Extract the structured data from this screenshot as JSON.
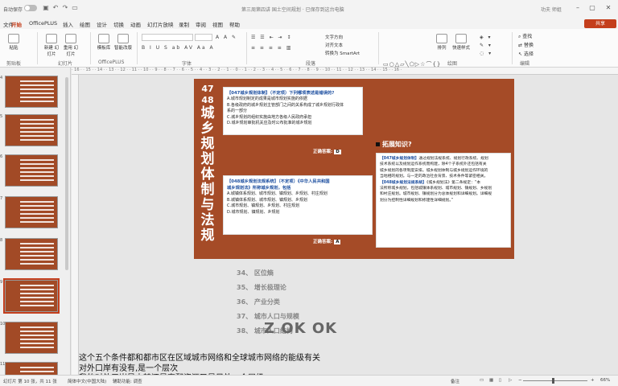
{
  "titlebar": {
    "autosave_label": "自动保存",
    "doc_title": "第三周第四讲 国土空间规划 · 已保存到这台电脑",
    "user_name": "功夫 师姐"
  },
  "menu": {
    "tabs": [
      "文件",
      "开始",
      "OfficePLUS",
      "插入",
      "绘图",
      "设计",
      "切换",
      "动画",
      "幻灯片放映",
      "录制",
      "审阅",
      "视图",
      "帮助"
    ],
    "active_tab": "开始",
    "share_label": "共享"
  },
  "ribbon": {
    "paste": "粘贴",
    "new_slide": "新建\n幻灯片",
    "reuse": "重用\n幻灯片",
    "template": "模板库",
    "smart": "智能改版",
    "font_name": "",
    "font_size": "",
    "group_clipboard": "剪贴板",
    "group_slides": "幻灯片",
    "group_officeplus": "OfficePLUS",
    "group_font": "字体",
    "group_paragraph": "段落",
    "group_drawing": "绘图",
    "group_editing": "编辑",
    "text_direction": "文字方向",
    "align_text": "对齐文本",
    "smartart": "转换为 SmartArt",
    "arrange": "排列",
    "quick_styles": "快速样式",
    "find": "查找",
    "replace": "替换",
    "select": "选择"
  },
  "ruler_text": "· 16 · · 15 · · 14 · · 13 · · 12 · · 11 · · 10 · · 9 · · 8 · · 7 · · 6 · · 5 · · 4 · · 3 · · 2 · · 1 · · 0 · · 1 · · 2 · · 3 · · 4 · · 5 · · 6 · · 7 · · 8 · · 9 · · 10 · · 11 · · 12 · · 13 · · 14 · · 15 · · 16 ·",
  "slide": {
    "title_num1": "47",
    "title_num2": "48",
    "title_chars": [
      "城",
      "乡",
      "规",
      "划",
      "体",
      "制",
      "与",
      "法",
      "规"
    ],
    "q1": {
      "head": "【047城乡规划体制】（不定项）下列哪项表述是错误的?",
      "options": [
        "A.城市规划制定的成果是城市规划实施的依据",
        "B.各级政府的城乡规划主管部门之间的关系构成了城乡规划行政体",
        "系的一部分",
        "C.城乡规划的组织实施由地方各级人民政府承担",
        "D.城乡规划审批机关应及时公布批准的城乡规划"
      ],
      "answer_label": "正确答案:",
      "answer_value": "D"
    },
    "q2": {
      "head": "【048城乡规划法规系统】（不定项）《中华人民共和国",
      "head2": "城乡规划法》所称城乡规划，包括",
      "options": [
        "A.城镇体系规划、城市规划、镇规划、乡规划、村庄规划",
        "B.城镇体系规划、城市规划、镇规划、乡规划",
        "C.城市规划、镇规划、乡规划、村庄规划",
        "D.城市规划、镇规划、乡规划"
      ],
      "answer_label": "正确答案:",
      "answer_value": "A"
    },
    "extension": {
      "label": "拓展知识?",
      "lines": [
        {
          "hl": "【047城乡规划体制】",
          "text": "通过规划法规系统、规划行政系统、规划"
        },
        {
          "hl": "",
          "text": "技术系统以及规划运作系统而构建，除4个子系统外还包括有关"
        },
        {
          "hl": "",
          "text": "城乡规划的各项制度安排。城乡规划体制与城乡规划运作环境的"
        },
        {
          "hl": "",
          "text": "当地相的规划。与一定的政治社会背景、技术条件等紧密相关。"
        },
        {
          "hl": "【048城乡规划法规系统】",
          "text": "《城乡规划法》第二条规定：“本"
        },
        {
          "hl": "",
          "text": "法所称城乡规划，包括城镇体系规划、城市规划、镇规划、乡规划"
        },
        {
          "hl": "",
          "text": "和村庄规划。城市规划、镇规划分为总体规划和详细规划。详细规"
        },
        {
          "hl": "",
          "text": "划分为控制性详细规划和修建性详细规划。”"
        }
      ]
    }
  },
  "notes": {
    "items": [
      "34、 区位熵",
      "35、 增长极理论",
      "36、 产业分类",
      "37、 城市人口与规模",
      "38、 城市人口结构"
    ],
    "watermark": "Z OK OK"
  },
  "subtitles": [
    "这个五个条件都和都市区在区域城市网络和全球城市网络的能级有关",
    "对外口岸有没有,是一个层次",
    "我的对外口岸是中转还是直配资源又是另外一个层级"
  ],
  "thumbnails": {
    "numbers": [
      "4",
      "5",
      "6",
      "7",
      "8",
      "9",
      "10",
      "11"
    ],
    "selected_index": 6
  },
  "status": {
    "slide_info": "幻灯片 第 10 张，共 11 张",
    "language": "简体中文(中国大陆)",
    "accessibility": "辅助功能: 调查",
    "notes_btn": "备注",
    "zoom": "66%"
  }
}
